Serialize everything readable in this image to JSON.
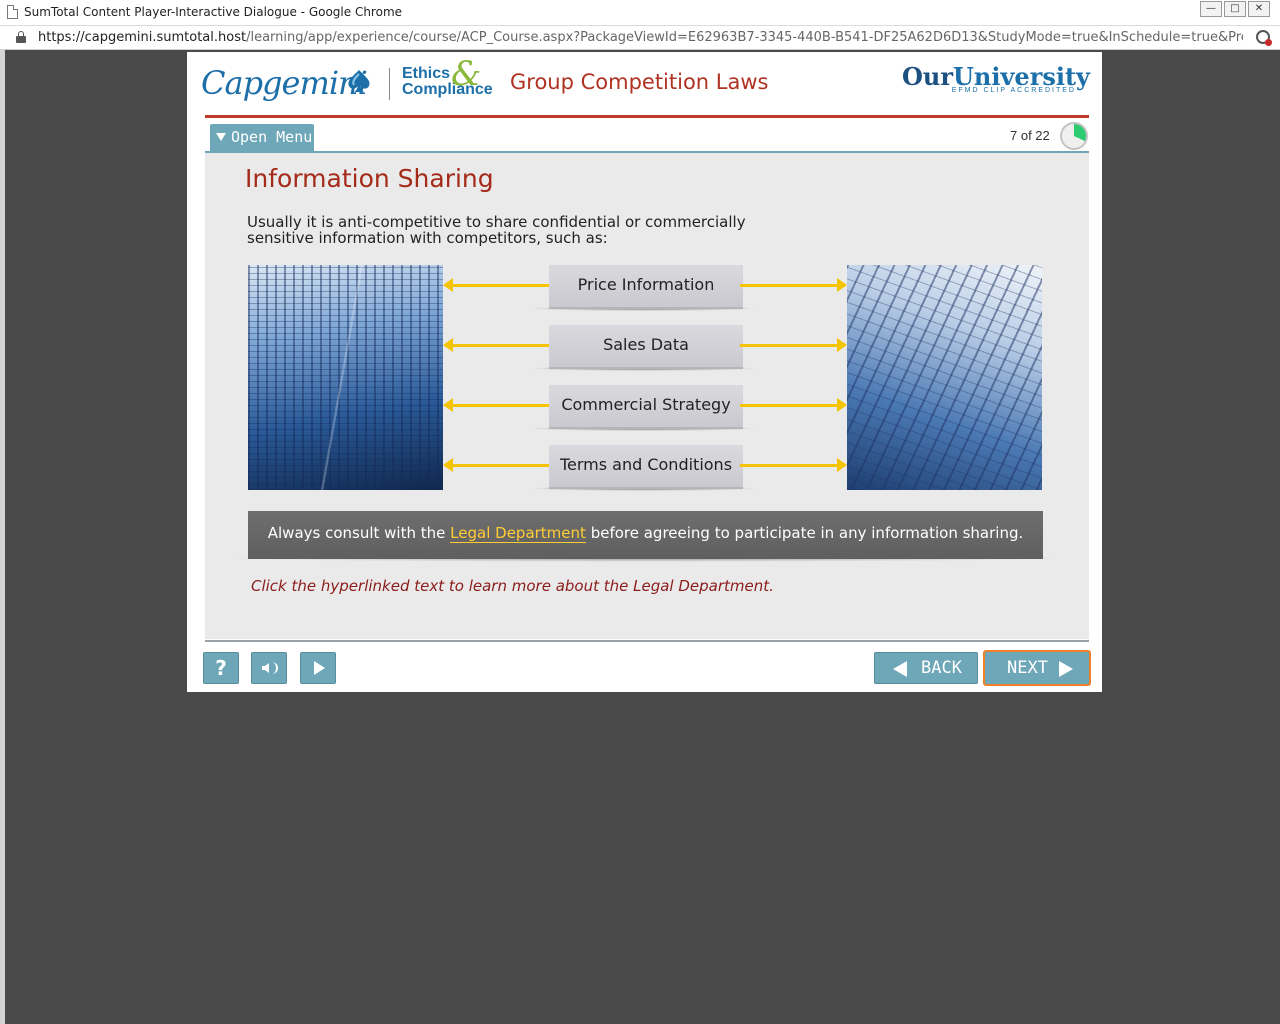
{
  "window": {
    "title": "SumTotal Content Player-Interactive Dialogue - Google Chrome",
    "controls": [
      "—",
      "□",
      "✕"
    ]
  },
  "address": {
    "url_host": "https://capgemini.sumtotal.host",
    "url_path": "/learning/app/experience/course/ACP_Course.aspx?PackageViewId=E62963B7-3345-440B-B541-DF25A62D6D13&StudyMode=true&InSchedule=true&Preview=..."
  },
  "header": {
    "brand": "Capgemini",
    "ethics_line1": "Ethics",
    "ethics_line2": "Compliance",
    "ampersand": "&",
    "course_title": "Group Competition Laws",
    "university_our": "Our",
    "university_name": "University",
    "university_sub": "EFMD CLIP ACCREDITED"
  },
  "nav": {
    "open_menu": "Open Menu",
    "page_count": "7 of 22",
    "progress_fraction": 0.32
  },
  "content": {
    "title": "Information Sharing",
    "intro": "Usually it is anti-competitive to share confidential or commercially sensitive information with competitors, such as:",
    "items": [
      "Price Information",
      "Sales Data",
      "Commercial Strategy",
      "Terms and Conditions"
    ],
    "consult_before": "Always consult with the",
    "consult_link": "Legal Department",
    "consult_after": "before agreeing to participate in any information sharing.",
    "hint": "Click the hyperlinked text to learn more about the Legal Department."
  },
  "controls": {
    "help_label": "?",
    "back_label": "BACK",
    "next_label": "NEXT"
  },
  "colors": {
    "accent_teal": "#6ea7b8",
    "brand_blue": "#1c6fa8",
    "title_red": "#a52a1a",
    "arrow_yellow": "#f5c400",
    "next_outline": "#f07f2a",
    "progress_green": "#2ecc71"
  }
}
